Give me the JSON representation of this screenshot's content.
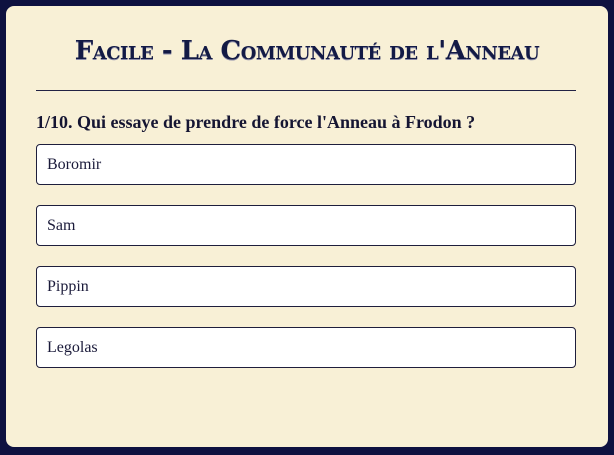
{
  "quiz": {
    "title": "Facile - La Communauté de l'Anneau",
    "question": "1/10. Qui essaye de prendre de force l'Anneau à Frodon ?",
    "options": [
      "Boromir",
      "Sam",
      "Pippin",
      "Legolas"
    ]
  },
  "colors": {
    "page_background": "#0e1140",
    "card_background": "#f8f0d6",
    "title_color": "#131a45",
    "option_background": "#ffffff",
    "option_border": "#1e1e3c"
  }
}
